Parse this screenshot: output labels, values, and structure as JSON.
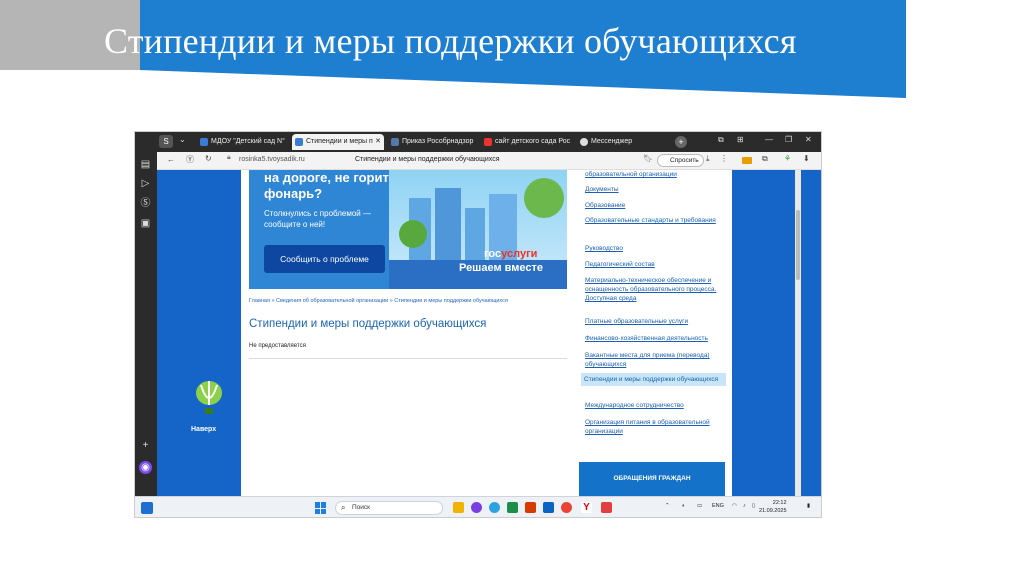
{
  "slide": {
    "title": "Стипендии и меры поддержки обучающихся",
    "colors": {
      "accent": "#1e7fd0",
      "grey": "#b5b5b5"
    }
  },
  "browser": {
    "tabs": [
      {
        "label": "МДОУ \"Детский сад N°",
        "icon": "site-icon",
        "active": false
      },
      {
        "label": "Стипендии и меры п",
        "icon": "site-icon",
        "active": true
      },
      {
        "label": "Приказ Рособрнадзор",
        "icon": "doc-icon",
        "active": false
      },
      {
        "label": "сайт детского сада Рос",
        "icon": "yandex-icon",
        "active": false
      },
      {
        "label": "Мессенджер",
        "icon": "messenger-icon",
        "active": false
      }
    ],
    "url": "rosinka5.tvoysadik.ru",
    "page_title": "Стипендии и меры поддержки обучающихся",
    "ask_label": "Спросить"
  },
  "banner": {
    "question": "на дороге, не горит\nфонарь?",
    "subtitle": "Столкнулись с проблемой —\nсообщите о ней!",
    "button": "Сообщить о проблеме",
    "gos_left": "гос",
    "gos_right": "услуги",
    "slogan": "Решаем вместе"
  },
  "page": {
    "breadcrumb": "Главная » Сведения об образовательной организации » Стипендии и меры поддержки обучающихся",
    "heading": "Стипендии и меры поддержки обучающихся",
    "body": "Не предоставляется",
    "back_to_top": "Наверх"
  },
  "nav": {
    "items": [
      {
        "label": "образовательной организации",
        "active": false
      },
      {
        "label": "Документы",
        "active": false
      },
      {
        "label": "Образование",
        "active": false
      },
      {
        "label": "Образовательные стандарты и требования",
        "active": false
      },
      {
        "label": "Руководство",
        "active": false
      },
      {
        "label": "Педагогический состав",
        "active": false
      },
      {
        "label": "Материально-техническое обеспечение и оснащенность образовательного процесса. Доступная среда",
        "active": false
      },
      {
        "label": "Платные образовательные услуги",
        "active": false
      },
      {
        "label": "Финансово-хозяйственная деятельность",
        "active": false
      },
      {
        "label": "Вакантные места для приема (перевода) обучающихся",
        "active": false
      },
      {
        "label": "Стипендии и меры поддержки обучающихся",
        "active": true
      },
      {
        "label": "Международное сотрудничество",
        "active": false
      },
      {
        "label": "Организация питания в образовательной организации",
        "active": false
      }
    ],
    "appeal": "ОБРАЩЕНИЯ ГРАЖДАН"
  },
  "taskbar": {
    "search": "Поиск",
    "lang": "ENG",
    "time": "22:12",
    "date": "21.09.2025"
  }
}
